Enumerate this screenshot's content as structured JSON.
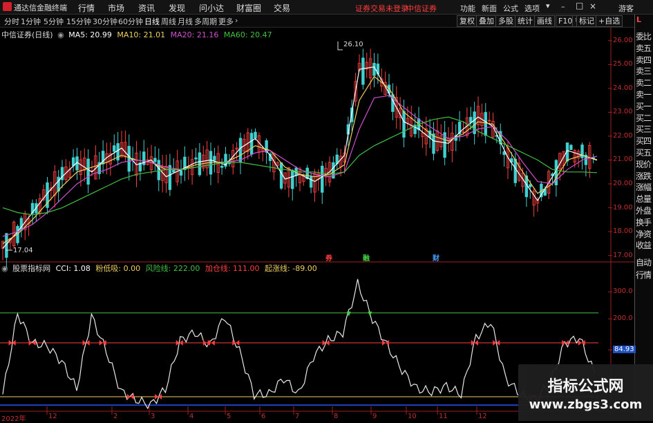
{
  "app": {
    "name": "通达信金融终端",
    "account_notice": "证券交易未登录",
    "broker_name": "中信证券"
  },
  "menu": [
    "行情",
    "市场",
    "资讯",
    "发现",
    "问小达",
    "财富圈",
    "交易"
  ],
  "top_right": {
    "items": [
      "功能",
      "新面",
      "公式",
      "选项"
    ],
    "guest": "游客"
  },
  "periods": [
    "分时",
    "1分钟",
    "5分钟",
    "15分钟",
    "30分钟",
    "60分钟",
    "日线",
    "周线",
    "月线",
    "多周期",
    "更多"
  ],
  "active_period": "日线",
  "toolbar": [
    "复权",
    "叠加",
    "多股",
    "统计",
    "画线",
    "F10",
    "标记",
    "+自选"
  ],
  "right_panel": [
    "委比",
    "卖五",
    "卖四",
    "卖三",
    "卖二",
    "卖一",
    "买一",
    "买二",
    "买三",
    "买四",
    "买五",
    "现价",
    "涨跌",
    "涨幅",
    "总量",
    "外盘",
    "换手",
    "净资",
    "收益",
    "自动",
    "行情"
  ],
  "right_panel_mark": "L",
  "main_chart": {
    "title": "中信证券(日线)",
    "ma": [
      {
        "label": "MA5: 20.99",
        "color": "#ffffff"
      },
      {
        "label": "MA10: 21.01",
        "color": "#f0d060"
      },
      {
        "label": "MA20: 21.16",
        "color": "#d050d0"
      },
      {
        "label": "MA60: 20.47",
        "color": "#40c040"
      }
    ],
    "high_label": "26.10",
    "low_label": "17.04",
    "y_ticks": [
      "26.00",
      "25.00",
      "24.00",
      "23.00",
      "22.00",
      "21.00",
      "20.00",
      "19.00",
      "18.00",
      "17.00"
    ],
    "signal_tags": [
      {
        "text": "券",
        "color": "#ff4040"
      },
      {
        "text": "融",
        "color": "#40d040"
      },
      {
        "text": "财",
        "color": "#40a0ff"
      }
    ]
  },
  "indicator": {
    "name": "股票指标网",
    "values": [
      {
        "label": "CCI: 1.08",
        "color": "#ffffff"
      },
      {
        "label": "粉低吸: 0.00",
        "color": "#f0d060"
      },
      {
        "label": "风险线: 222.00",
        "color": "#40c040"
      },
      {
        "label": "加仓线: 111.00",
        "color": "#ff4040"
      },
      {
        "label": "起涨线: -89.00",
        "color": "#f0d060"
      }
    ],
    "y_ticks": [
      "300.0",
      "200.0",
      "84.93"
    ],
    "levels": {
      "risk": 222,
      "add": 111,
      "start": -89
    }
  },
  "x_labels": [
    "2022年",
    "12",
    "2",
    "3",
    "4",
    "5",
    "6",
    "7",
    "8",
    "9",
    "10",
    "11",
    "12"
  ],
  "watermark": {
    "line1": "指标公式网",
    "line2": "www.zbgs3.com"
  },
  "chart_data": {
    "type": "line",
    "title": "",
    "series": [
      {
        "name": "MA5",
        "values": [
          17.3,
          18.0,
          18.8,
          19.6,
          20.3,
          20.9,
          20.5,
          21.1,
          21.5,
          20.8,
          21.0,
          20.3,
          20.6,
          20.9,
          21.0,
          20.8,
          21.5,
          21.9,
          21.2,
          20.2,
          20.4,
          20.1,
          20.5,
          21.2,
          24.8,
          24.9,
          23.8,
          22.6,
          22.3,
          21.8,
          21.7,
          22.3,
          22.8,
          22.4,
          21.1,
          20.2,
          19.3,
          20.3,
          21.4,
          21.2,
          20.99
        ]
      },
      {
        "name": "MA10",
        "values": [
          17.5,
          17.9,
          18.5,
          19.2,
          19.9,
          20.5,
          20.7,
          20.9,
          21.2,
          21.0,
          20.9,
          20.6,
          20.6,
          20.8,
          20.9,
          20.9,
          21.2,
          21.6,
          21.4,
          20.7,
          20.4,
          20.3,
          20.4,
          20.8,
          23.5,
          24.5,
          24.0,
          23.0,
          22.5,
          22.0,
          21.8,
          22.1,
          22.6,
          22.5,
          21.5,
          20.5,
          19.6,
          20.0,
          21.0,
          21.2,
          21.01
        ]
      },
      {
        "name": "MA20",
        "values": [
          17.8,
          18.0,
          18.3,
          18.8,
          19.4,
          20.0,
          20.4,
          20.6,
          20.9,
          21.0,
          20.9,
          20.7,
          20.6,
          20.7,
          20.8,
          20.9,
          21.0,
          21.3,
          21.4,
          21.0,
          20.6,
          20.4,
          20.3,
          20.5,
          22.3,
          23.6,
          23.7,
          23.2,
          22.7,
          22.3,
          21.9,
          22.0,
          22.3,
          22.4,
          21.8,
          20.9,
          20.1,
          20.0,
          20.6,
          21.0,
          21.16
        ]
      },
      {
        "name": "MA60",
        "values": [
          19.0,
          18.8,
          18.7,
          18.8,
          19.0,
          19.3,
          19.6,
          19.9,
          20.2,
          20.4,
          20.5,
          20.6,
          20.6,
          20.7,
          20.8,
          20.9,
          20.9,
          20.8,
          20.7,
          20.6,
          20.5,
          20.5,
          20.4,
          20.5,
          21.2,
          21.6,
          21.9,
          22.2,
          22.5,
          22.7,
          22.8,
          22.6,
          22.2,
          21.9,
          21.6,
          21.3,
          21.0,
          20.6,
          20.5,
          20.5,
          20.47
        ]
      }
    ],
    "ylim": [
      16.7,
      26.4
    ],
    "indicator_series": {
      "name": "CCI",
      "values": [
        -80,
        220,
        110,
        100,
        40,
        -60,
        210,
        80,
        -70,
        -100,
        -120,
        -60,
        120,
        150,
        100,
        210,
        80,
        -80,
        -80,
        -20,
        -80,
        60,
        120,
        150,
        330,
        200,
        100,
        10,
        -60,
        -70,
        -50,
        -80,
        130,
        190,
        -20,
        -80,
        -100,
        -40,
        110,
        130,
        1.08
      ],
      "ylim": [
        -130,
        370
      ]
    }
  }
}
